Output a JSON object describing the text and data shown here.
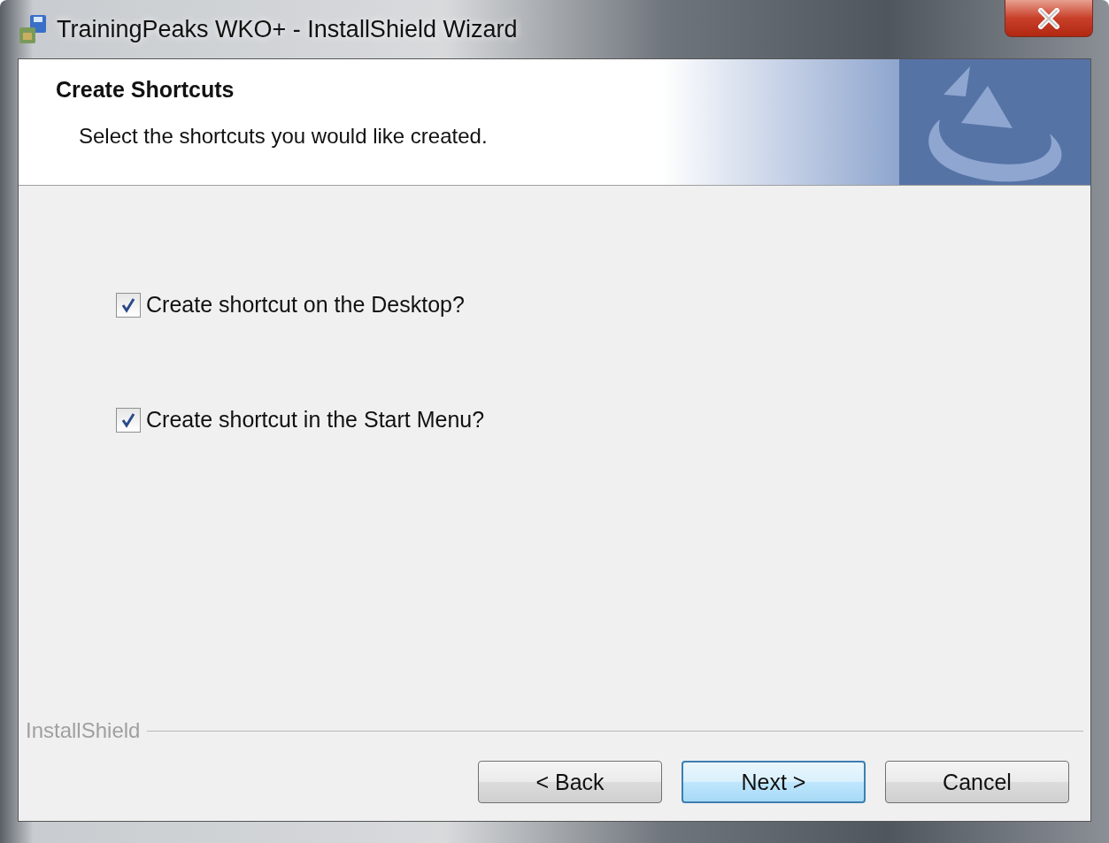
{
  "window": {
    "title": "TrainingPeaks WKO+ - InstallShield Wizard"
  },
  "header": {
    "title": "Create Shortcuts",
    "subtitle": "Select the shortcuts you would like created."
  },
  "options": [
    {
      "label": "Create shortcut on the Desktop?",
      "checked": true
    },
    {
      "label": "Create shortcut in the Start Menu?",
      "checked": true
    }
  ],
  "footer": {
    "brand": "InstallShield"
  },
  "buttons": [
    {
      "label": "< Back",
      "default": false
    },
    {
      "label": "Next >",
      "default": true
    },
    {
      "label": "Cancel",
      "default": false
    }
  ]
}
